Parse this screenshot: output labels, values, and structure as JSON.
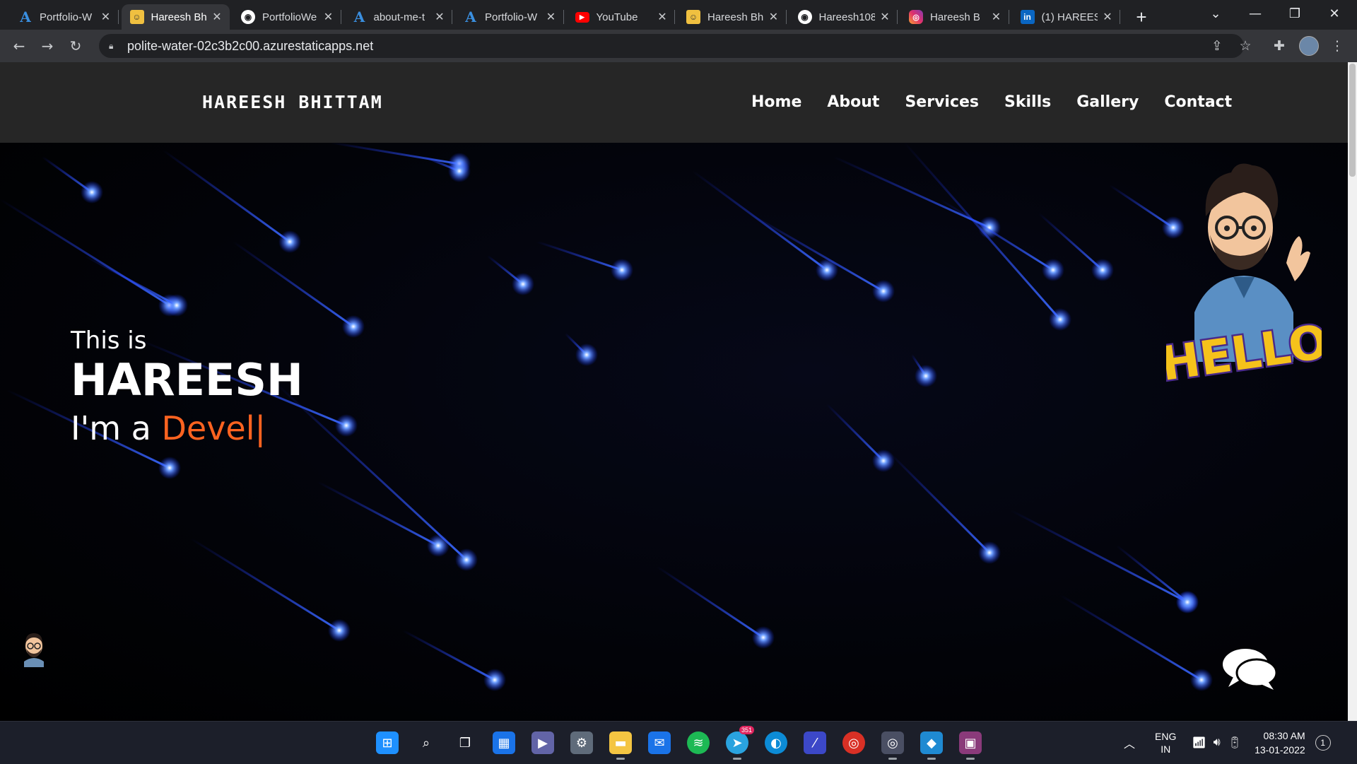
{
  "browser": {
    "tabs": [
      {
        "title": "Portfolio-W",
        "icon": "azure-icon",
        "active": false
      },
      {
        "title": "Hareesh Bh",
        "icon": "site-favicon",
        "active": true
      },
      {
        "title": "PortfolioWe",
        "icon": "github-icon",
        "active": false
      },
      {
        "title": "about-me-t",
        "icon": "azure-icon",
        "active": false
      },
      {
        "title": "Portfolio-W",
        "icon": "azure-icon",
        "active": false
      },
      {
        "title": "YouTube",
        "icon": "youtube-icon",
        "active": false
      },
      {
        "title": "Hareesh Bh",
        "icon": "site-favicon",
        "active": false
      },
      {
        "title": "Hareesh108",
        "icon": "github-icon",
        "active": false
      },
      {
        "title": "Hareesh B",
        "icon": "instagram-icon",
        "active": false
      },
      {
        "title": "(1) HAREES",
        "icon": "linkedin-icon",
        "active": false
      }
    ],
    "url": "polite-water-02c3b2c00.azurestaticapps.net"
  },
  "site": {
    "logo": "HAREESH BHITTAM",
    "nav": [
      "Home",
      "About",
      "Services",
      "Skills",
      "Gallery",
      "Contact"
    ],
    "hero": {
      "intro": "This is",
      "name": "HAREESH",
      "role_prefix": "I'm a ",
      "role_typed": "Devel",
      "cursor": "|"
    },
    "sticker_text": "HELLO"
  },
  "taskbar": {
    "apps": [
      "start-icon",
      "search-icon",
      "task-view-icon",
      "widgets-icon",
      "teams-chat-icon",
      "settings-icon",
      "file-explorer-icon",
      "mail-icon",
      "spotify-icon",
      "telegram-icon",
      "edge-icon",
      "app-icon",
      "chrome-icon",
      "chrome-profile-icon",
      "vscode-icon",
      "teams-icon"
    ],
    "telegram_badge": "351",
    "language": "ENG",
    "region": "IN",
    "time": "08:30 AM",
    "date": "13-01-2022",
    "notifications": "1"
  },
  "colors": {
    "accent": "#ff6320",
    "nav_bg": "#262626",
    "tab_strip": "#202124",
    "toolbar": "#35363a",
    "taskbar": "#1c1f2a"
  }
}
